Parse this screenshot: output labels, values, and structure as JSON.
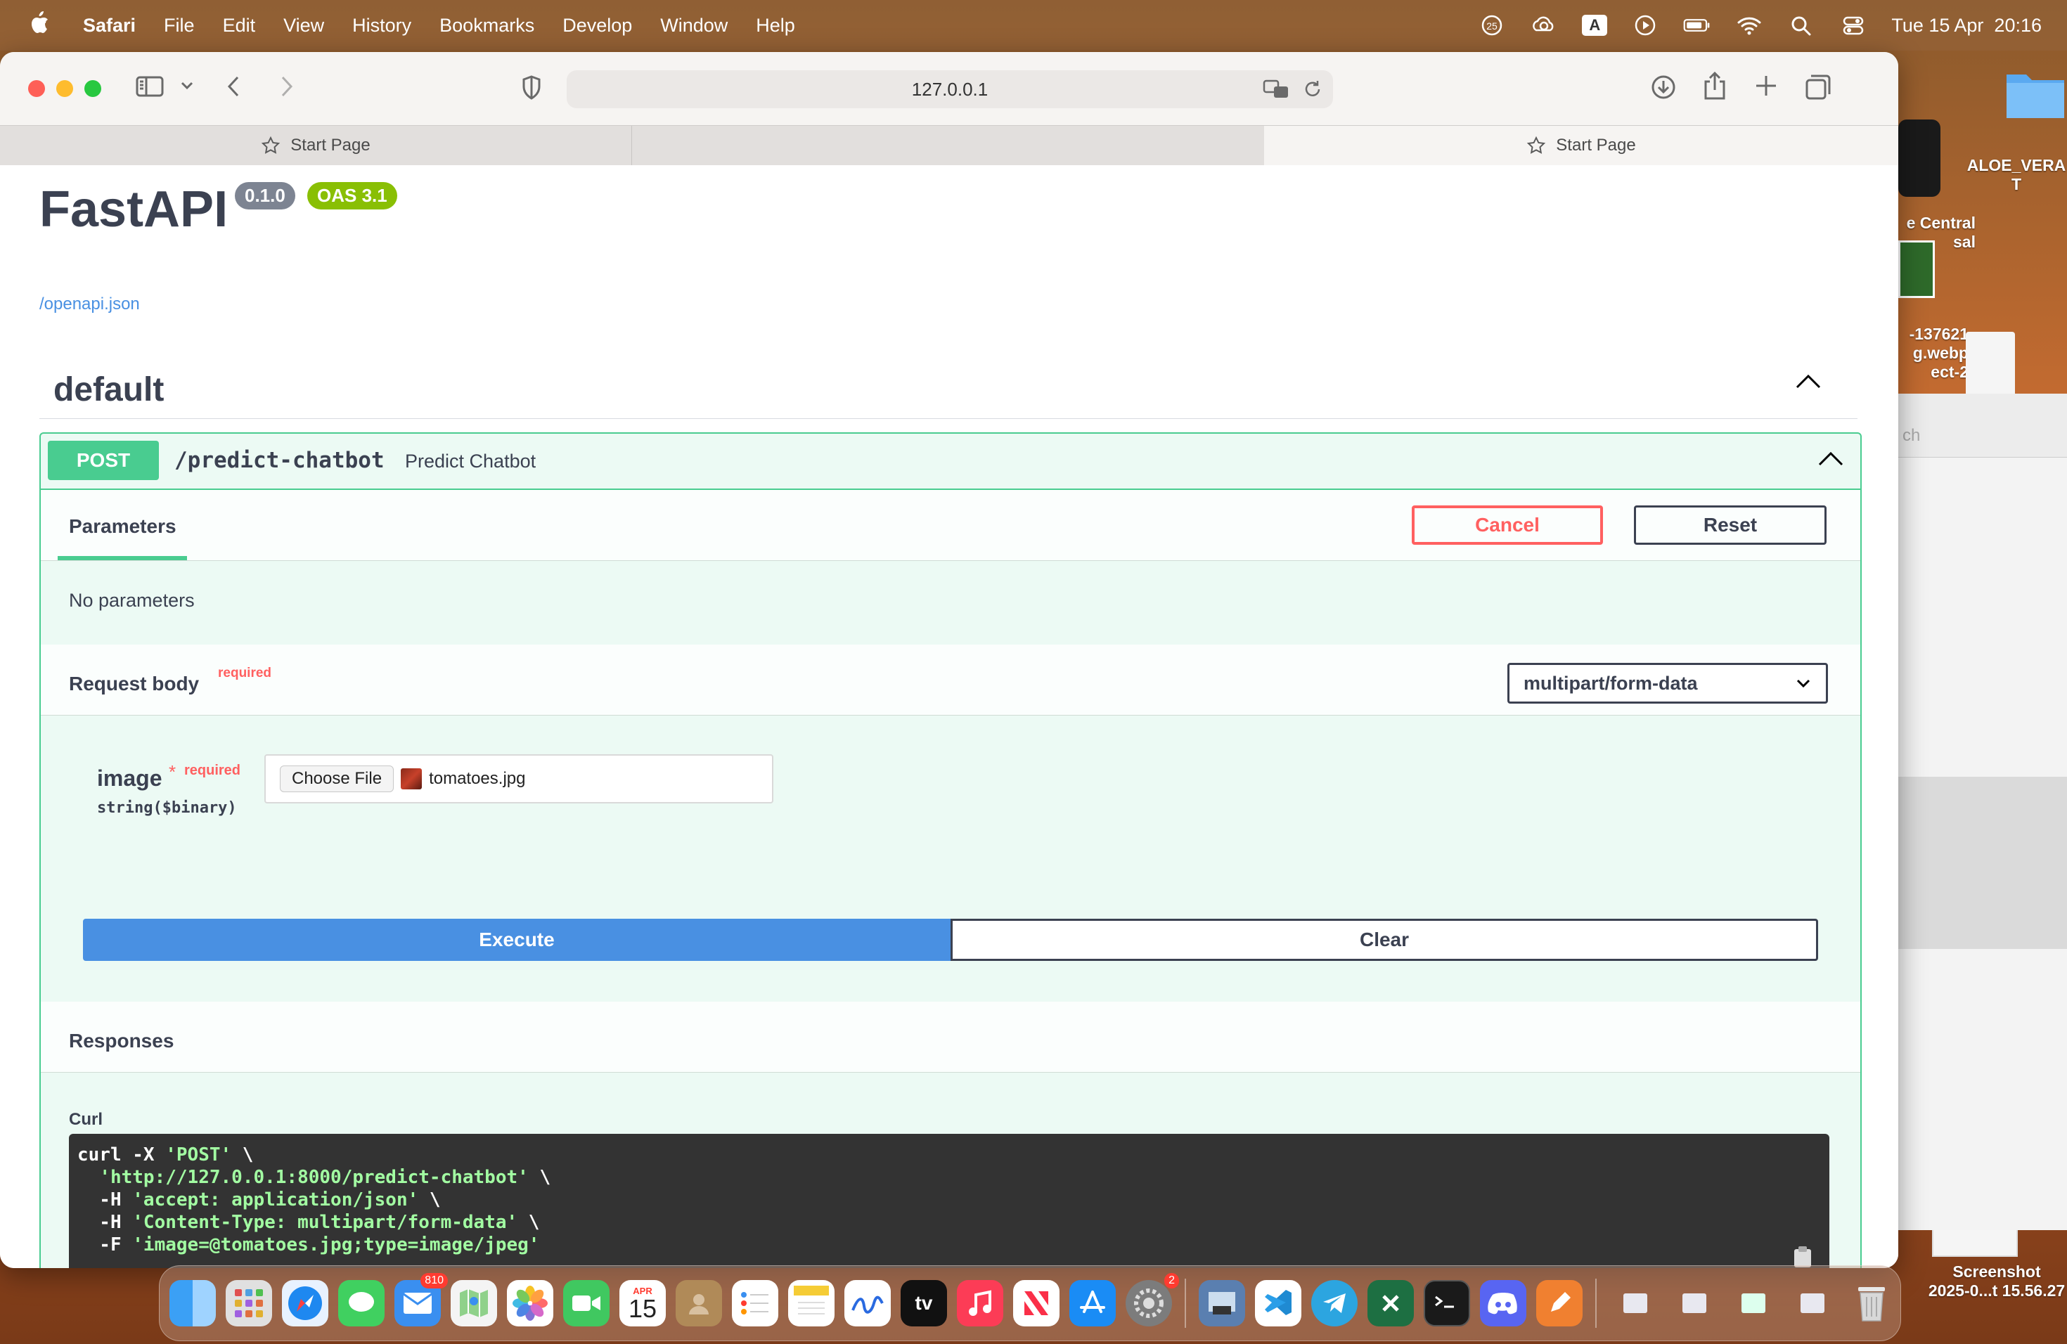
{
  "menubar": {
    "app_name": "Safari",
    "items": [
      "File",
      "Edit",
      "View",
      "History",
      "Bookmarks",
      "Develop",
      "Window",
      "Help"
    ],
    "status_badge": "25",
    "input_source": "A",
    "datetime": "Tue 15 Apr  20:16"
  },
  "desktop": {
    "folder_label": "ALOE_VERA\nT",
    "item2_label": "e Central\nsal",
    "item3_label": "-137621\ng.webp\nect-2",
    "screenshot_label": "Screenshot\n2025-0...t 15.56.27",
    "side_search": "ch"
  },
  "browser": {
    "url": "127.0.0.1",
    "tabs": [
      {
        "label": "Start Page"
      },
      {
        "label": "Start Page"
      }
    ]
  },
  "page": {
    "title": "FastAPI",
    "version": "0.1.0",
    "oas": "OAS 3.1",
    "openapi_link": "/openapi.json",
    "section": "default",
    "operation": {
      "method": "POST",
      "path": "/predict-chatbot",
      "summary": "Predict Chatbot",
      "parameters_tab": "Parameters",
      "cancel_label": "Cancel",
      "reset_label": "Reset",
      "no_params": "No parameters",
      "request_body_label": "Request body",
      "required_label": "required",
      "content_type": "multipart/form-data",
      "param": {
        "name": "image",
        "star": "*",
        "required": "required",
        "type": "string($binary)",
        "choose_file": "Choose File",
        "file_name": "tomatoes.jpg"
      },
      "execute_label": "Execute",
      "clear_label": "Clear",
      "responses_label": "Responses",
      "curl_label": "Curl",
      "curl_lines": [
        {
          "pre": "curl -X ",
          "str": "'POST'",
          "post": " \\"
        },
        {
          "pre": "  ",
          "str": "'http://127.0.0.1:8000/predict-chatbot'",
          "post": " \\"
        },
        {
          "pre": "  -H ",
          "str": "'accept: application/json'",
          "post": " \\"
        },
        {
          "pre": "  -H ",
          "str": "'Content-Type: multipart/form-data'",
          "post": " \\"
        },
        {
          "pre": "  -F ",
          "str": "'image=@tomatoes.jpg;type=image/jpeg'",
          "post": ""
        }
      ]
    }
  },
  "dock": {
    "mail_badge": "810",
    "calendar_month": "APR",
    "calendar_day": "15",
    "settings_badge": "2",
    "tv_label": "tv"
  },
  "colors": {
    "post_green": "#49cc90",
    "execute_blue": "#4990e2",
    "cancel_red": "#ff6060",
    "text_dark": "#3b4151"
  }
}
